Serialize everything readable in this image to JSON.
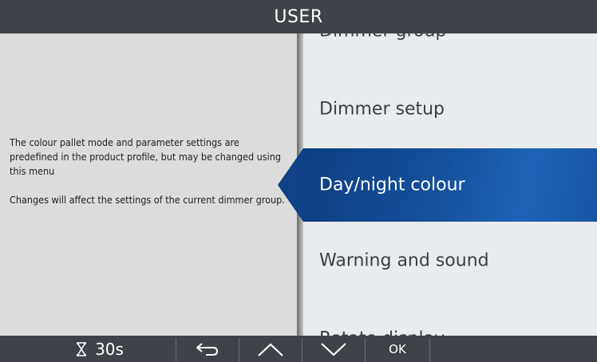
{
  "header": {
    "title": "USER"
  },
  "help": {
    "paragraph1": "The colour pallet mode and parameter settings are predefined in the product profile, but may be changed using this menu",
    "paragraph2": "Changes will affect the settings of the current dimmer group."
  },
  "menu": {
    "items": [
      {
        "label": "Dimmer group"
      },
      {
        "label": "Dimmer setup"
      },
      {
        "label": "Day/night colour",
        "selected": true
      },
      {
        "label": "Warning and sound"
      },
      {
        "label": "Rotate display"
      }
    ]
  },
  "footer": {
    "timer_icon": "hourglass-icon",
    "timer_label": "30s",
    "back_icon": "back-arrow-icon",
    "up_icon": "chevron-up-icon",
    "down_icon": "chevron-down-icon",
    "ok_label": "OK"
  },
  "colors": {
    "bar_background": "#3e4349",
    "selected_background": "#14509b",
    "panel_background": "#dcdcdc",
    "menu_background": "#e9ecee"
  }
}
